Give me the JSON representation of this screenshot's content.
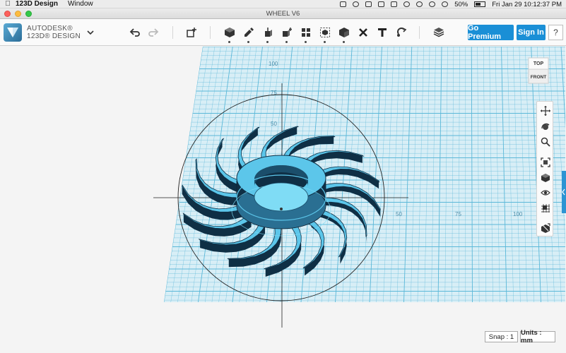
{
  "menubar": {
    "app_name": "123D Design",
    "menus": [
      "Window"
    ],
    "battery": "50%",
    "clock": "Fri Jan 29  10:12:37 PM"
  },
  "window": {
    "title": "WHEEL V6"
  },
  "brand": {
    "line1": "AUTODESK®",
    "line2": "123D® DESIGN"
  },
  "toolbar": {
    "icons": [
      "undo-icon",
      "redo-icon",
      "transform-icon",
      "primitives-icon",
      "sketch-icon",
      "construct-icon",
      "modify-icon",
      "pattern-icon",
      "group-icon",
      "combine-icon",
      "delete-icon",
      "text-icon",
      "snap-icon",
      "material-icon"
    ],
    "premium_label": "Go Premium",
    "signin_label": "Sign In",
    "help_label": "?"
  },
  "viewcube": {
    "top_label": "TOP",
    "front_label": "FRONT"
  },
  "grid": {
    "major_color": "#5bb8d8",
    "axis_labels_vertical": [
      "100",
      "75",
      "50"
    ],
    "axis_labels_horizontal": [
      "50",
      "75",
      "100"
    ]
  },
  "model": {
    "fill": "#5cc6ea",
    "dark": "#0f2f45"
  },
  "status": {
    "snap": "Snap : 1",
    "units": "Units : mm"
  }
}
